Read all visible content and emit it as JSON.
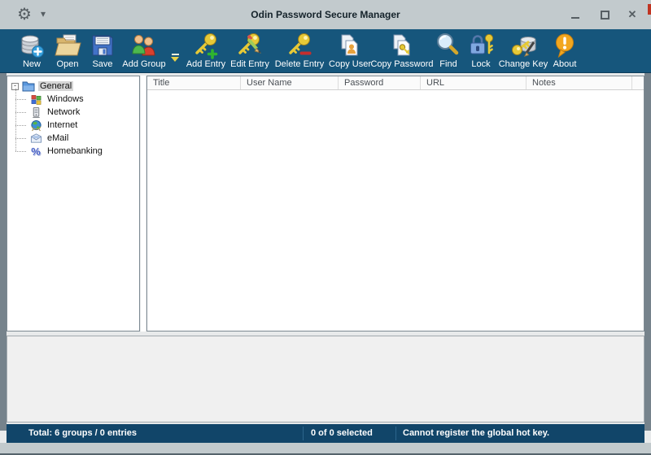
{
  "window": {
    "title": "Odin Password Secure Manager"
  },
  "titlebar": {
    "menu_gear_glyph": "⚙",
    "menu_dropdown_glyph": "▾",
    "close_glyph": "✕"
  },
  "toolbar": {
    "buttons": [
      {
        "label": "New",
        "icon": "database-new-icon"
      },
      {
        "label": "Open",
        "icon": "open-folder-icon"
      },
      {
        "label": "Save",
        "icon": "save-floppy-icon"
      },
      {
        "label": "Add Group",
        "icon": "add-group-icon",
        "has_dropdown": true
      },
      {
        "label": "Add Entry",
        "icon": "add-entry-key-icon"
      },
      {
        "label": "Edit Entry",
        "icon": "edit-entry-key-icon"
      },
      {
        "label": "Delete Entry",
        "icon": "delete-entry-key-icon"
      },
      {
        "label": "Copy User",
        "icon": "copy-user-icon"
      },
      {
        "label": "Copy Password",
        "icon": "copy-password-icon"
      },
      {
        "label": "Find",
        "icon": "find-magnifier-icon"
      },
      {
        "label": "Lock",
        "icon": "lock-icon"
      },
      {
        "label": "Change Key",
        "icon": "change-key-icon"
      },
      {
        "label": "About",
        "icon": "about-warning-icon"
      }
    ]
  },
  "tree": {
    "root": {
      "label": "General",
      "icon": "folder-icon",
      "expander_glyph": "-",
      "selected": true
    },
    "children": [
      {
        "label": "Windows",
        "icon": "windows-icon"
      },
      {
        "label": "Network",
        "icon": "network-icon"
      },
      {
        "label": "Internet",
        "icon": "internet-globe-icon"
      },
      {
        "label": "eMail",
        "icon": "email-icon"
      },
      {
        "label": "Homebanking",
        "icon": "homebanking-percent-icon",
        "glyph": "%"
      }
    ]
  },
  "list": {
    "columns": [
      "Title",
      "User Name",
      "Password",
      "URL",
      "Notes"
    ],
    "rows": []
  },
  "statusbar": {
    "total": "Total: 6 groups / 0 entries",
    "selected": "0 of 0 selected",
    "message": "Cannot register the global hot key."
  },
  "colors": {
    "toolbar_bg": "#16567c",
    "statusbar_bg": "#114569",
    "titlebar_bg": "#c2cacd",
    "accent_red": "#c03422"
  }
}
